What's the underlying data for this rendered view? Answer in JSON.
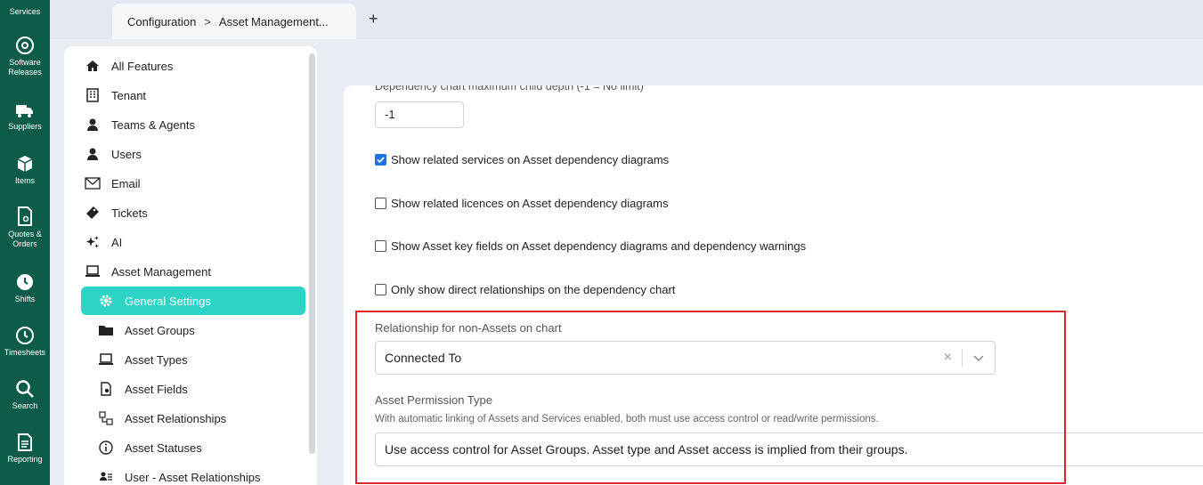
{
  "rail": {
    "items": [
      {
        "label": "Services",
        "icon": "services-icon"
      },
      {
        "label": "Software Releases",
        "icon": "disc-icon"
      },
      {
        "label": "Suppliers",
        "icon": "truck-icon"
      },
      {
        "label": "Items",
        "icon": "box-icon"
      },
      {
        "label": "Quotes & Orders",
        "icon": "document-icon"
      },
      {
        "label": "Shifts",
        "icon": "clock-icon"
      },
      {
        "label": "Timesheets",
        "icon": "timer-icon"
      },
      {
        "label": "Search",
        "icon": "search-icon"
      },
      {
        "label": "Reporting",
        "icon": "report-icon"
      }
    ]
  },
  "tabs": {
    "breadcrumb_root": "Configuration",
    "breadcrumb_sep": ">",
    "breadcrumb_current": "Asset Management...",
    "add_label": "+"
  },
  "sidebar": {
    "items": [
      {
        "label": "All Features",
        "icon": "home-icon"
      },
      {
        "label": "Tenant",
        "icon": "building-icon"
      },
      {
        "label": "Teams & Agents",
        "icon": "agent-icon"
      },
      {
        "label": "Users",
        "icon": "user-icon"
      },
      {
        "label": "Email",
        "icon": "email-icon"
      },
      {
        "label": "Tickets",
        "icon": "ticket-icon"
      },
      {
        "label": "AI",
        "icon": "sparkle-icon"
      },
      {
        "label": "Asset Management",
        "icon": "laptop-icon"
      },
      {
        "label": "General Settings",
        "icon": "gear-icon",
        "active": true
      },
      {
        "label": "Asset Groups",
        "icon": "folder-icon"
      },
      {
        "label": "Asset Types",
        "icon": "laptop-icon"
      },
      {
        "label": "Asset Fields",
        "icon": "file-gear-icon"
      },
      {
        "label": "Asset Relationships",
        "icon": "relationship-icon"
      },
      {
        "label": "Asset Statuses",
        "icon": "info-icon"
      },
      {
        "label": "User - Asset Relationships",
        "icon": "user-list-icon"
      }
    ]
  },
  "main": {
    "depth_label": "Dependency chart maximum child depth (-1 = No limit)",
    "depth_value": "-1",
    "checkboxes": [
      {
        "label": "Show related services on Asset dependency diagrams",
        "checked": true
      },
      {
        "label": "Show related licences on Asset dependency diagrams",
        "checked": false
      },
      {
        "label": "Show Asset key fields on Asset dependency diagrams and dependency warnings",
        "checked": false
      },
      {
        "label": "Only show direct relationships on the dependency chart",
        "checked": false
      }
    ],
    "relationship_label": "Relationship for non-Assets on chart",
    "relationship_value": "Connected To",
    "clear_glyph": "×",
    "permission_label": "Asset Permission Type",
    "permission_hint": "With automatic linking of Assets and Services enabled, both must use access control or read/write permissions.",
    "permission_value": "Use access control for Asset Groups. Asset type and Asset access is implied from their groups."
  },
  "colors": {
    "rail_bg": "#0d5c4a",
    "active_bg": "#2dd3c4",
    "highlight_border": "#d9262f",
    "checkbox_on": "#1a73e8"
  }
}
